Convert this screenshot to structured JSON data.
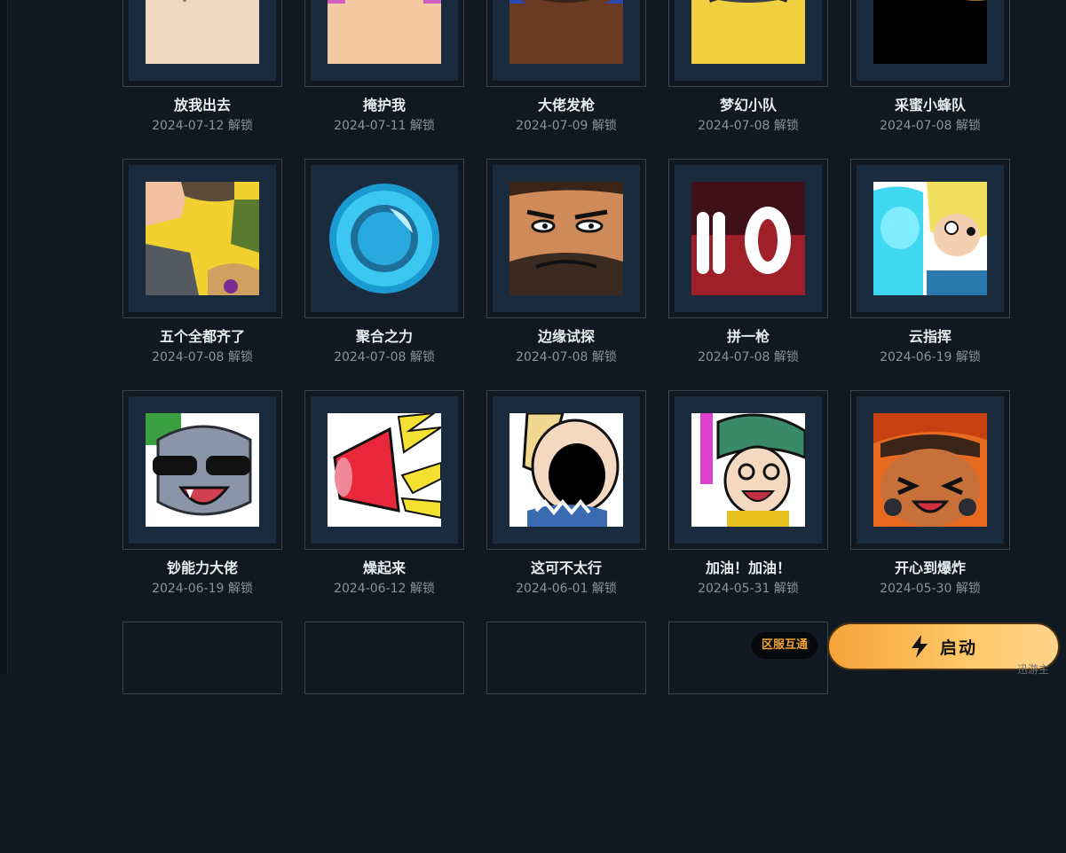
{
  "achievements": [
    {
      "name": "放我出去",
      "date": "2024-07-12",
      "icon": "grin-boy-avatar"
    },
    {
      "name": "掩护我",
      "date": "2024-07-11",
      "icon": "freckled-kid-avatar"
    },
    {
      "name": "大佬发枪",
      "date": "2024-07-09",
      "icon": "bearded-grin-avatar"
    },
    {
      "name": "梦幻小队",
      "date": "2024-07-08",
      "icon": "gray-bunny-avatar"
    },
    {
      "name": "采蜜小蜂队",
      "date": "2024-07-08",
      "icon": "bee-stripe-avatar"
    },
    {
      "name": "五个全都齐了",
      "date": "2024-07-08",
      "icon": "five-fists-avatar"
    },
    {
      "name": "聚合之力",
      "date": "2024-07-08",
      "icon": "cyan-orb-avatar"
    },
    {
      "name": "边缘试探",
      "date": "2024-07-08",
      "icon": "smirking-man-avatar"
    },
    {
      "name": "拼一枪",
      "date": "2024-07-08",
      "icon": "red-ammo-avatar"
    },
    {
      "name": "云指挥",
      "date": "2024-06-19",
      "icon": "ghost-duo-avatar"
    },
    {
      "name": "钞能力大佬",
      "date": "2024-06-19",
      "icon": "sunglasses-sloth-avatar"
    },
    {
      "name": "燥起来",
      "date": "2024-06-12",
      "icon": "megaphone-avatar"
    },
    {
      "name": "这可不太行",
      "date": "2024-06-01",
      "icon": "screaming-blonde-avatar"
    },
    {
      "name": "加油！加油！",
      "date": "2024-05-31",
      "icon": "cheering-girl-avatar"
    },
    {
      "name": "开心到爆炸",
      "date": "2024-05-30",
      "icon": "laughing-cowboy-avatar"
    }
  ],
  "unlock_suffix": "解锁",
  "bottom": {
    "region_badge": "区服互通",
    "launch_label": "启动",
    "corner_text": "迅游主"
  },
  "colors": {
    "background": "#101922",
    "card_inner": "#1a2b3d",
    "badge_text": "#f2a431",
    "launch_gradient_start": "#f5a33a",
    "launch_gradient_end": "#ffd48a"
  }
}
